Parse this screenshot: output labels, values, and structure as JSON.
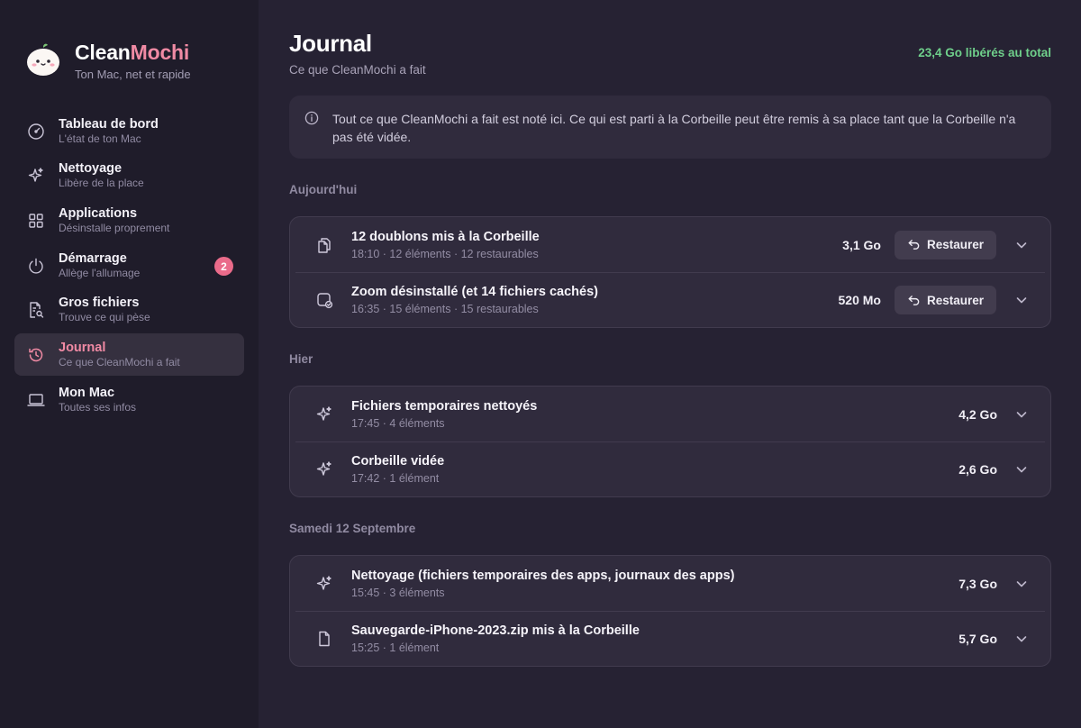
{
  "brand": {
    "name_part1": "Clean",
    "name_part2": "Mochi",
    "tagline": "Ton Mac, net et rapide"
  },
  "sidebar": {
    "items": [
      {
        "title": "Tableau de bord",
        "sub": "L'état de ton Mac",
        "icon": "gauge-icon"
      },
      {
        "title": "Nettoyage",
        "sub": "Libère de la place",
        "icon": "sparkle-icon"
      },
      {
        "title": "Applications",
        "sub": "Désinstalle proprement",
        "icon": "grid-icon"
      },
      {
        "title": "Démarrage",
        "sub": "Allège l'allumage",
        "icon": "power-icon",
        "badge": "2"
      },
      {
        "title": "Gros fichiers",
        "sub": "Trouve ce qui pèse",
        "icon": "file-search-icon"
      },
      {
        "title": "Journal",
        "sub": "Ce que CleanMochi a fait",
        "icon": "history-icon",
        "active": true
      },
      {
        "title": "Mon Mac",
        "sub": "Toutes ses infos",
        "icon": "laptop-icon"
      }
    ]
  },
  "header": {
    "title": "Journal",
    "subtitle": "Ce que CleanMochi a fait",
    "total": "23,4 Go libérés au total"
  },
  "info": {
    "text": "Tout ce que CleanMochi a fait est noté ici. Ce qui est parti à la Corbeille peut être remis à sa place tant que la Corbeille n'a pas été vidée."
  },
  "sections": [
    {
      "label": "Aujourd'hui",
      "rows": [
        {
          "title": "12 doublons mis à la Corbeille",
          "meta": "18:10 · 12 éléments · 12 restaurables",
          "size": "3,1 Go",
          "restore": "Restaurer",
          "icon": "copy-icon"
        },
        {
          "title": "Zoom désinstallé (et 14 fichiers cachés)",
          "meta": "16:35 · 15 éléments · 15 restaurables",
          "size": "520 Mo",
          "restore": "Restaurer",
          "icon": "app-removed-icon"
        }
      ]
    },
    {
      "label": "Hier",
      "rows": [
        {
          "title": "Fichiers temporaires nettoyés",
          "meta": "17:45 · 4 éléments",
          "size": "4,2 Go",
          "icon": "sparkle-icon"
        },
        {
          "title": "Corbeille vidée",
          "meta": "17:42 · 1 élément",
          "size": "2,6 Go",
          "icon": "sparkle-icon"
        }
      ]
    },
    {
      "label": "Samedi 12 Septembre",
      "rows": [
        {
          "title": "Nettoyage (fichiers temporaires des apps, journaux des apps)",
          "meta": "15:45 · 3 éléments",
          "size": "7,3 Go",
          "icon": "sparkle-icon"
        },
        {
          "title": "Sauvegarde-iPhone-2023.zip mis à la Corbeille",
          "meta": "15:25 · 1 élément",
          "size": "5,7 Go",
          "icon": "file-icon"
        }
      ]
    }
  ],
  "colors": {
    "accent": "#f08aa4",
    "success": "#6fcf8b",
    "badge": "#ea6b8a"
  }
}
